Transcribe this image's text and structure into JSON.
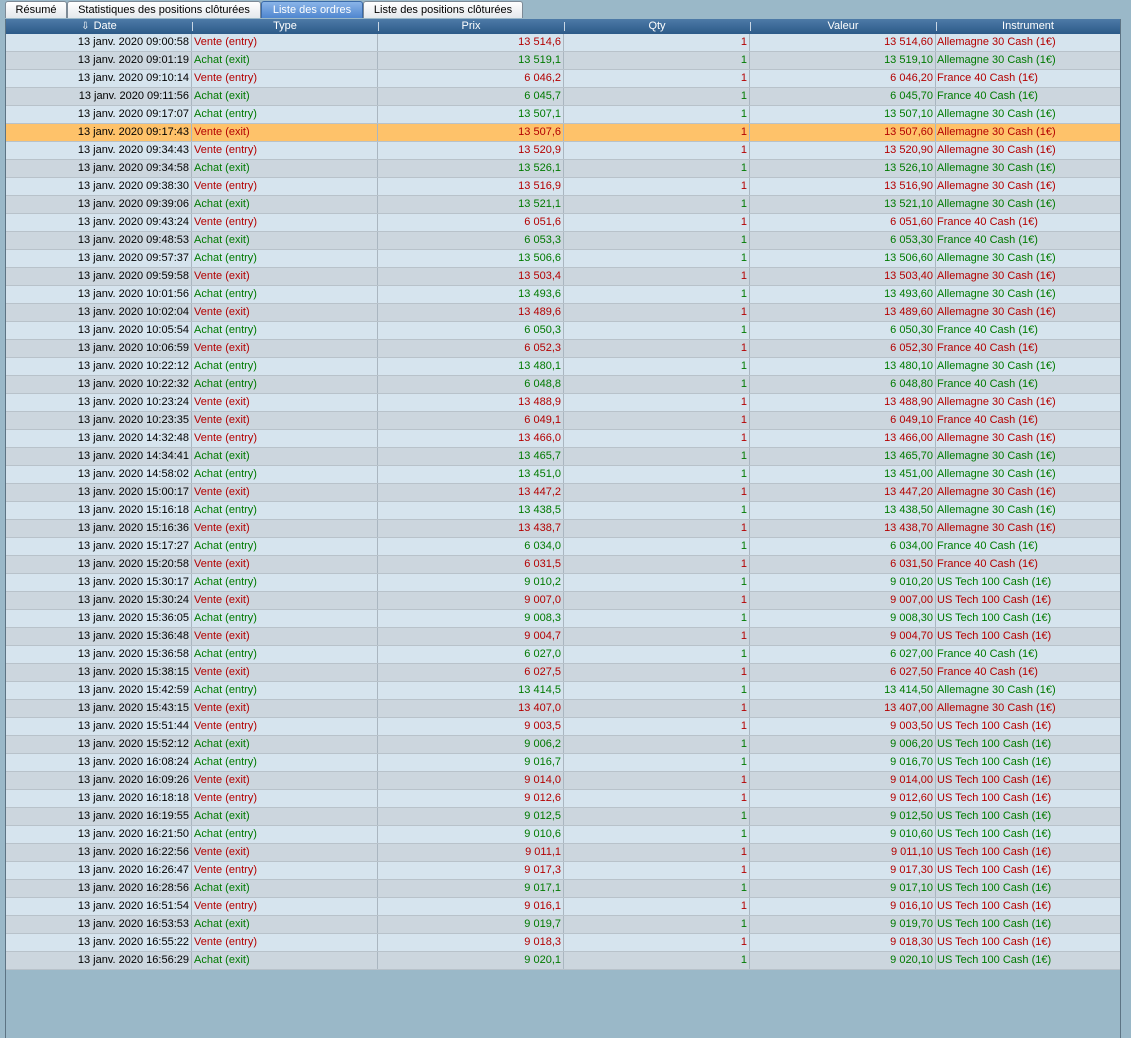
{
  "tabs": [
    {
      "label": "Résumé",
      "active": false
    },
    {
      "label": "Statistiques des positions clôturées",
      "active": false
    },
    {
      "label": "Liste des ordres",
      "active": true
    },
    {
      "label": "Liste des positions clôturées",
      "active": false
    }
  ],
  "columns": {
    "date": "Date",
    "type": "Type",
    "prix": "Prix",
    "qty": "Qty",
    "valeur": "Valeur",
    "instrument": "Instrument"
  },
  "sort_icon": "⇩",
  "selected_row": 5,
  "colors": {
    "sell": "#b40000",
    "buy": "#007a00",
    "selection": "#fec26a",
    "header": "#2c5a88"
  },
  "orders": [
    {
      "date": "13 janv. 2020 09:00:58",
      "type": "Vente (entry)",
      "prix": "13 514,6",
      "qty": "1",
      "valeur": "13 514,60",
      "instrument": "Allemagne 30 Cash (1€)"
    },
    {
      "date": "13 janv. 2020 09:01:19",
      "type": "Achat (exit)",
      "prix": "13 519,1",
      "qty": "1",
      "valeur": "13 519,10",
      "instrument": "Allemagne 30 Cash (1€)"
    },
    {
      "date": "13 janv. 2020 09:10:14",
      "type": "Vente (entry)",
      "prix": "6 046,2",
      "qty": "1",
      "valeur": "6 046,20",
      "instrument": "France 40 Cash (1€)"
    },
    {
      "date": "13 janv. 2020 09:11:56",
      "type": "Achat (exit)",
      "prix": "6 045,7",
      "qty": "1",
      "valeur": "6 045,70",
      "instrument": "France 40 Cash (1€)"
    },
    {
      "date": "13 janv. 2020 09:17:07",
      "type": "Achat (entry)",
      "prix": "13 507,1",
      "qty": "1",
      "valeur": "13 507,10",
      "instrument": "Allemagne 30 Cash (1€)"
    },
    {
      "date": "13 janv. 2020 09:17:43",
      "type": "Vente (exit)",
      "prix": "13 507,6",
      "qty": "1",
      "valeur": "13 507,60",
      "instrument": "Allemagne 30 Cash (1€)"
    },
    {
      "date": "13 janv. 2020 09:34:43",
      "type": "Vente (entry)",
      "prix": "13 520,9",
      "qty": "1",
      "valeur": "13 520,90",
      "instrument": "Allemagne 30 Cash (1€)"
    },
    {
      "date": "13 janv. 2020 09:34:58",
      "type": "Achat (exit)",
      "prix": "13 526,1",
      "qty": "1",
      "valeur": "13 526,10",
      "instrument": "Allemagne 30 Cash (1€)"
    },
    {
      "date": "13 janv. 2020 09:38:30",
      "type": "Vente (entry)",
      "prix": "13 516,9",
      "qty": "1",
      "valeur": "13 516,90",
      "instrument": "Allemagne 30 Cash (1€)"
    },
    {
      "date": "13 janv. 2020 09:39:06",
      "type": "Achat (exit)",
      "prix": "13 521,1",
      "qty": "1",
      "valeur": "13 521,10",
      "instrument": "Allemagne 30 Cash (1€)"
    },
    {
      "date": "13 janv. 2020 09:43:24",
      "type": "Vente (entry)",
      "prix": "6 051,6",
      "qty": "1",
      "valeur": "6 051,60",
      "instrument": "France 40 Cash (1€)"
    },
    {
      "date": "13 janv. 2020 09:48:53",
      "type": "Achat (exit)",
      "prix": "6 053,3",
      "qty": "1",
      "valeur": "6 053,30",
      "instrument": "France 40 Cash (1€)"
    },
    {
      "date": "13 janv. 2020 09:57:37",
      "type": "Achat (entry)",
      "prix": "13 506,6",
      "qty": "1",
      "valeur": "13 506,60",
      "instrument": "Allemagne 30 Cash (1€)"
    },
    {
      "date": "13 janv. 2020 09:59:58",
      "type": "Vente (exit)",
      "prix": "13 503,4",
      "qty": "1",
      "valeur": "13 503,40",
      "instrument": "Allemagne 30 Cash (1€)"
    },
    {
      "date": "13 janv. 2020 10:01:56",
      "type": "Achat (entry)",
      "prix": "13 493,6",
      "qty": "1",
      "valeur": "13 493,60",
      "instrument": "Allemagne 30 Cash (1€)"
    },
    {
      "date": "13 janv. 2020 10:02:04",
      "type": "Vente (exit)",
      "prix": "13 489,6",
      "qty": "1",
      "valeur": "13 489,60",
      "instrument": "Allemagne 30 Cash (1€)"
    },
    {
      "date": "13 janv. 2020 10:05:54",
      "type": "Achat (entry)",
      "prix": "6 050,3",
      "qty": "1",
      "valeur": "6 050,30",
      "instrument": "France 40 Cash (1€)"
    },
    {
      "date": "13 janv. 2020 10:06:59",
      "type": "Vente (exit)",
      "prix": "6 052,3",
      "qty": "1",
      "valeur": "6 052,30",
      "instrument": "France 40 Cash (1€)"
    },
    {
      "date": "13 janv. 2020 10:22:12",
      "type": "Achat (entry)",
      "prix": "13 480,1",
      "qty": "1",
      "valeur": "13 480,10",
      "instrument": "Allemagne 30 Cash (1€)"
    },
    {
      "date": "13 janv. 2020 10:22:32",
      "type": "Achat (entry)",
      "prix": "6 048,8",
      "qty": "1",
      "valeur": "6 048,80",
      "instrument": "France 40 Cash (1€)"
    },
    {
      "date": "13 janv. 2020 10:23:24",
      "type": "Vente (exit)",
      "prix": "13 488,9",
      "qty": "1",
      "valeur": "13 488,90",
      "instrument": "Allemagne 30 Cash (1€)"
    },
    {
      "date": "13 janv. 2020 10:23:35",
      "type": "Vente (exit)",
      "prix": "6 049,1",
      "qty": "1",
      "valeur": "6 049,10",
      "instrument": "France 40 Cash (1€)"
    },
    {
      "date": "13 janv. 2020 14:32:48",
      "type": "Vente (entry)",
      "prix": "13 466,0",
      "qty": "1",
      "valeur": "13 466,00",
      "instrument": "Allemagne 30 Cash (1€)"
    },
    {
      "date": "13 janv. 2020 14:34:41",
      "type": "Achat (exit)",
      "prix": "13 465,7",
      "qty": "1",
      "valeur": "13 465,70",
      "instrument": "Allemagne 30 Cash (1€)"
    },
    {
      "date": "13 janv. 2020 14:58:02",
      "type": "Achat (entry)",
      "prix": "13 451,0",
      "qty": "1",
      "valeur": "13 451,00",
      "instrument": "Allemagne 30 Cash (1€)"
    },
    {
      "date": "13 janv. 2020 15:00:17",
      "type": "Vente (exit)",
      "prix": "13 447,2",
      "qty": "1",
      "valeur": "13 447,20",
      "instrument": "Allemagne 30 Cash (1€)"
    },
    {
      "date": "13 janv. 2020 15:16:18",
      "type": "Achat (entry)",
      "prix": "13 438,5",
      "qty": "1",
      "valeur": "13 438,50",
      "instrument": "Allemagne 30 Cash (1€)"
    },
    {
      "date": "13 janv. 2020 15:16:36",
      "type": "Vente (exit)",
      "prix": "13 438,7",
      "qty": "1",
      "valeur": "13 438,70",
      "instrument": "Allemagne 30 Cash (1€)"
    },
    {
      "date": "13 janv. 2020 15:17:27",
      "type": "Achat (entry)",
      "prix": "6 034,0",
      "qty": "1",
      "valeur": "6 034,00",
      "instrument": "France 40 Cash (1€)"
    },
    {
      "date": "13 janv. 2020 15:20:58",
      "type": "Vente (exit)",
      "prix": "6 031,5",
      "qty": "1",
      "valeur": "6 031,50",
      "instrument": "France 40 Cash (1€)"
    },
    {
      "date": "13 janv. 2020 15:30:17",
      "type": "Achat (entry)",
      "prix": "9 010,2",
      "qty": "1",
      "valeur": "9 010,20",
      "instrument": "US Tech 100 Cash (1€)"
    },
    {
      "date": "13 janv. 2020 15:30:24",
      "type": "Vente (exit)",
      "prix": "9 007,0",
      "qty": "1",
      "valeur": "9 007,00",
      "instrument": "US Tech 100 Cash (1€)"
    },
    {
      "date": "13 janv. 2020 15:36:05",
      "type": "Achat (entry)",
      "prix": "9 008,3",
      "qty": "1",
      "valeur": "9 008,30",
      "instrument": "US Tech 100 Cash (1€)"
    },
    {
      "date": "13 janv. 2020 15:36:48",
      "type": "Vente (exit)",
      "prix": "9 004,7",
      "qty": "1",
      "valeur": "9 004,70",
      "instrument": "US Tech 100 Cash (1€)"
    },
    {
      "date": "13 janv. 2020 15:36:58",
      "type": "Achat (entry)",
      "prix": "6 027,0",
      "qty": "1",
      "valeur": "6 027,00",
      "instrument": "France 40 Cash (1€)"
    },
    {
      "date": "13 janv. 2020 15:38:15",
      "type": "Vente (exit)",
      "prix": "6 027,5",
      "qty": "1",
      "valeur": "6 027,50",
      "instrument": "France 40 Cash (1€)"
    },
    {
      "date": "13 janv. 2020 15:42:59",
      "type": "Achat (entry)",
      "prix": "13 414,5",
      "qty": "1",
      "valeur": "13 414,50",
      "instrument": "Allemagne 30 Cash (1€)"
    },
    {
      "date": "13 janv. 2020 15:43:15",
      "type": "Vente (exit)",
      "prix": "13 407,0",
      "qty": "1",
      "valeur": "13 407,00",
      "instrument": "Allemagne 30 Cash (1€)"
    },
    {
      "date": "13 janv. 2020 15:51:44",
      "type": "Vente (entry)",
      "prix": "9 003,5",
      "qty": "1",
      "valeur": "9 003,50",
      "instrument": "US Tech 100 Cash (1€)"
    },
    {
      "date": "13 janv. 2020 15:52:12",
      "type": "Achat (exit)",
      "prix": "9 006,2",
      "qty": "1",
      "valeur": "9 006,20",
      "instrument": "US Tech 100 Cash (1€)"
    },
    {
      "date": "13 janv. 2020 16:08:24",
      "type": "Achat (entry)",
      "prix": "9 016,7",
      "qty": "1",
      "valeur": "9 016,70",
      "instrument": "US Tech 100 Cash (1€)"
    },
    {
      "date": "13 janv. 2020 16:09:26",
      "type": "Vente (exit)",
      "prix": "9 014,0",
      "qty": "1",
      "valeur": "9 014,00",
      "instrument": "US Tech 100 Cash (1€)"
    },
    {
      "date": "13 janv. 2020 16:18:18",
      "type": "Vente (entry)",
      "prix": "9 012,6",
      "qty": "1",
      "valeur": "9 012,60",
      "instrument": "US Tech 100 Cash (1€)"
    },
    {
      "date": "13 janv. 2020 16:19:55",
      "type": "Achat (exit)",
      "prix": "9 012,5",
      "qty": "1",
      "valeur": "9 012,50",
      "instrument": "US Tech 100 Cash (1€)"
    },
    {
      "date": "13 janv. 2020 16:21:50",
      "type": "Achat (entry)",
      "prix": "9 010,6",
      "qty": "1",
      "valeur": "9 010,60",
      "instrument": "US Tech 100 Cash (1€)"
    },
    {
      "date": "13 janv. 2020 16:22:56",
      "type": "Vente (exit)",
      "prix": "9 011,1",
      "qty": "1",
      "valeur": "9 011,10",
      "instrument": "US Tech 100 Cash (1€)"
    },
    {
      "date": "13 janv. 2020 16:26:47",
      "type": "Vente (entry)",
      "prix": "9 017,3",
      "qty": "1",
      "valeur": "9 017,30",
      "instrument": "US Tech 100 Cash (1€)"
    },
    {
      "date": "13 janv. 2020 16:28:56",
      "type": "Achat (exit)",
      "prix": "9 017,1",
      "qty": "1",
      "valeur": "9 017,10",
      "instrument": "US Tech 100 Cash (1€)"
    },
    {
      "date": "13 janv. 2020 16:51:54",
      "type": "Vente (entry)",
      "prix": "9 016,1",
      "qty": "1",
      "valeur": "9 016,10",
      "instrument": "US Tech 100 Cash (1€)"
    },
    {
      "date": "13 janv. 2020 16:53:53",
      "type": "Achat (exit)",
      "prix": "9 019,7",
      "qty": "1",
      "valeur": "9 019,70",
      "instrument": "US Tech 100 Cash (1€)"
    },
    {
      "date": "13 janv. 2020 16:55:22",
      "type": "Vente (entry)",
      "prix": "9 018,3",
      "qty": "1",
      "valeur": "9 018,30",
      "instrument": "US Tech 100 Cash (1€)"
    },
    {
      "date": "13 janv. 2020 16:56:29",
      "type": "Achat (exit)",
      "prix": "9 020,1",
      "qty": "1",
      "valeur": "9 020,10",
      "instrument": "US Tech 100 Cash (1€)"
    }
  ]
}
